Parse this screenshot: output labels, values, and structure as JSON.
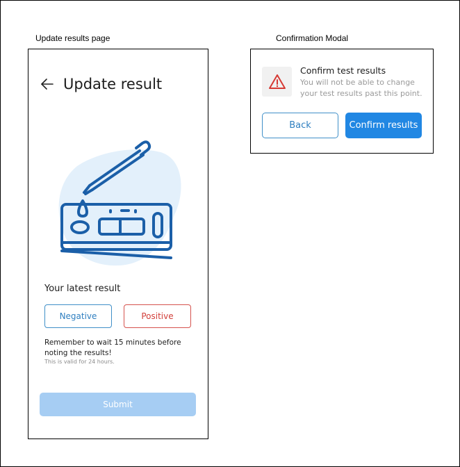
{
  "captions": {
    "left": "Update results page",
    "right": "Confirmation Modal"
  },
  "update_page": {
    "title": "Update result",
    "back_icon": "arrow-left-icon",
    "illustration_icon": "rapid-test-kit-illustration",
    "latest_result_label": "Your latest result",
    "options": {
      "negative": "Negative",
      "positive": "Positive"
    },
    "reminder": "Remember to wait 15 minutes before noting the results!",
    "validity": "This is valid for 24 hours.",
    "submit_label": "Submit"
  },
  "modal": {
    "icon": "warning-triangle-icon",
    "title": "Confirm test results",
    "body": "You will not be able to change your test results past this point.",
    "back_label": "Back",
    "confirm_label": "Confirm results"
  },
  "colors": {
    "primary": "#2187e3",
    "primary_disabled": "#a6cdf3",
    "negative_border": "#3f8fc8",
    "positive_border": "#d5524d",
    "illustration_blob": "#e3f0fb",
    "illustration_stroke": "#1b5fa8",
    "warning": "#d63a34"
  }
}
